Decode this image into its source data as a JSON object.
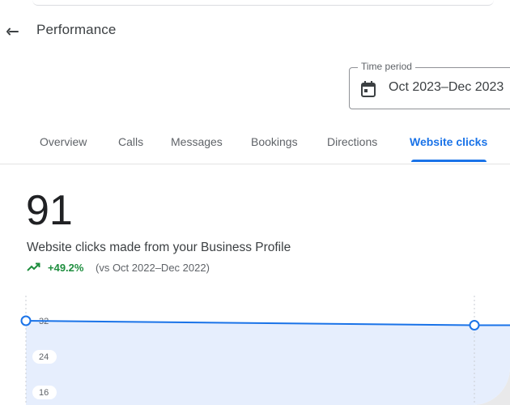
{
  "header": {
    "title": "Performance",
    "back_icon": "back-arrow-icon"
  },
  "time_period": {
    "label": "Time period",
    "value": "Oct 2023–Dec 2023",
    "icon": "calendar-icon"
  },
  "tabs": [
    {
      "label": "Overview",
      "active": false
    },
    {
      "label": "Calls",
      "active": false
    },
    {
      "label": "Messages",
      "active": false
    },
    {
      "label": "Bookings",
      "active": false
    },
    {
      "label": "Directions",
      "active": false
    },
    {
      "label": "Website clicks",
      "active": true
    }
  ],
  "metric": {
    "value": "91",
    "description": "Website clicks made from your Business Profile",
    "change": "+49.2%",
    "comparison": "(vs Oct 2022–Dec 2022)",
    "trend_icon": "trending-up-icon"
  },
  "colors": {
    "accent": "#1a73e8",
    "positive": "#1e8e3e",
    "area_fill": "#e6eefd"
  },
  "chart_data": {
    "type": "area",
    "x": [
      0,
      1,
      2
    ],
    "values": [
      32,
      31,
      31
    ],
    "y_ticks": [
      "32",
      "24",
      "16"
    ],
    "ylim": [
      16,
      32
    ],
    "grid": true
  }
}
